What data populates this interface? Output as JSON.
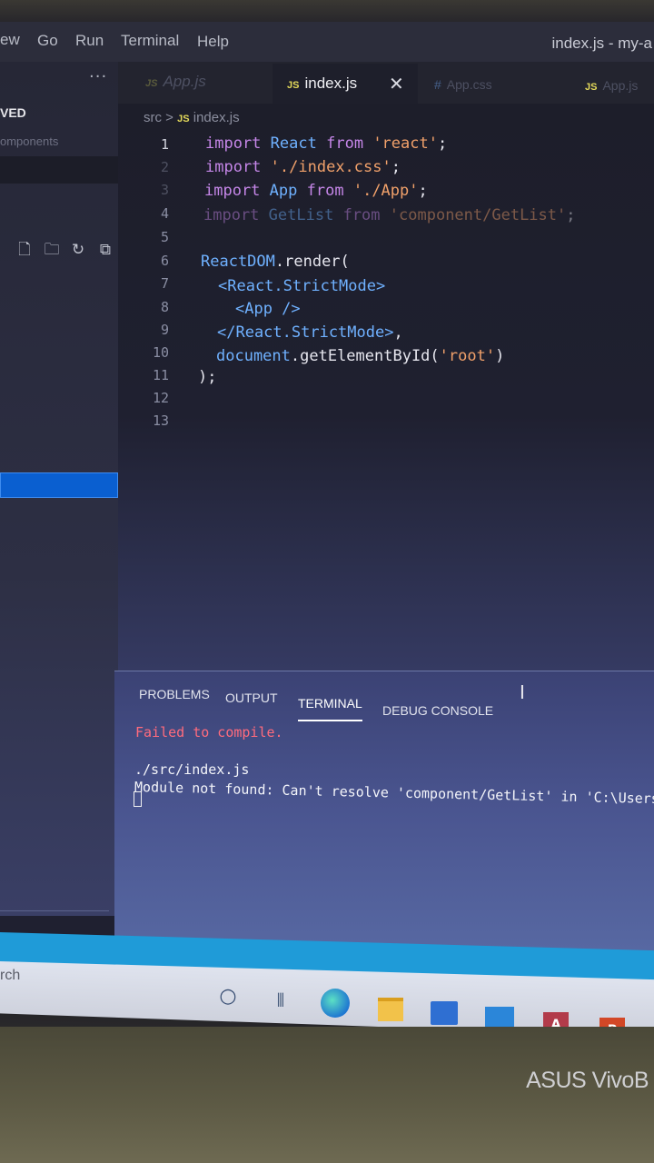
{
  "menu": {
    "items": [
      "ew",
      "Go",
      "Run",
      "Terminal",
      "Help"
    ],
    "window_title": "index.js - my-a"
  },
  "sidebar": {
    "more": "···",
    "section_header": "VED",
    "folder": "omponents",
    "action_icons": [
      "new-file-icon",
      "new-folder-icon",
      "refresh-icon",
      "collapse-all-icon"
    ]
  },
  "tabs": [
    {
      "label": "App.js",
      "icon": "JS",
      "active": false
    },
    {
      "label": "index.js",
      "icon": "JS",
      "active": true
    },
    {
      "label": "App.css",
      "icon": "#",
      "active": false
    },
    {
      "label": "App.js",
      "icon": "JS",
      "active": false
    }
  ],
  "breadcrumb": {
    "folder": "src",
    "sep": ">",
    "icon": "JS",
    "file": "index.js"
  },
  "editor": {
    "line_numbers": [
      "1",
      "2",
      "3",
      "4",
      "5",
      "6",
      "7",
      "8",
      "9",
      "10",
      "11",
      "12",
      "13"
    ]
  },
  "panel": {
    "tabs": [
      "PROBLEMS",
      "OUTPUT",
      "TERMINAL",
      "DEBUG CONSOLE"
    ],
    "active_tab": "TERMINAL",
    "error_title": "Failed to compile.",
    "file": "./src/index.js",
    "message": "Module not found: Can't resolve 'component/GetList' in 'C:\\Users"
  },
  "taskbar": {
    "search_text": "rch",
    "icons": [
      "cortana-icon",
      "task-view-icon",
      "edge-icon",
      "file-explorer-icon",
      "store-icon",
      "mail-icon",
      "access-icon",
      "powerpoint-icon"
    ]
  },
  "laptop": {
    "brand": "ASUS VivoB"
  }
}
